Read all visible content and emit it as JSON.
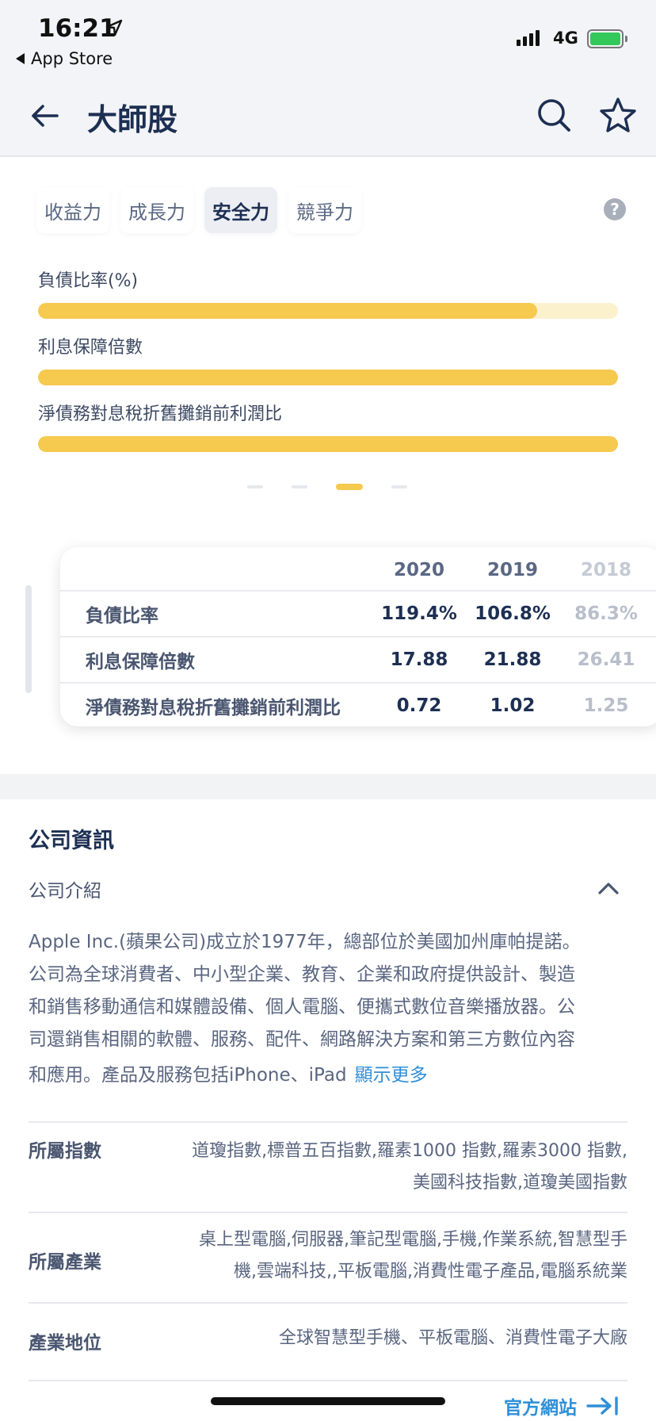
{
  "status_bar": {
    "time": "16:21",
    "back_app": "App Store",
    "network": "4G"
  },
  "header": {
    "title": "大師股",
    "icons": [
      "back-arrow-icon",
      "search-icon",
      "star-icon"
    ]
  },
  "tabs": [
    {
      "label": "收益力",
      "active": false
    },
    {
      "label": "成長力",
      "active": false
    },
    {
      "label": "安全力",
      "active": true
    },
    {
      "label": "競爭力",
      "active": false
    }
  ],
  "help_glyph": "?",
  "metrics": [
    {
      "label": "負債比率(%)",
      "fill": 0.86
    },
    {
      "label": "利息保障倍數",
      "fill": 1.0
    },
    {
      "label": "淨債務對息稅折舊攤銷前利潤比",
      "fill": 1.0
    }
  ],
  "pager": {
    "count": 4,
    "active_index": 2
  },
  "table": {
    "years": [
      "2020",
      "2019",
      "2018"
    ],
    "rows": [
      {
        "label": "負債比率",
        "values": [
          "119.4%",
          "106.8%",
          "86.3%"
        ]
      },
      {
        "label": "利息保障倍數",
        "values": [
          "17.88",
          "21.88",
          "26.41"
        ]
      },
      {
        "label": "淨債務對息稅折舊攤銷前利潤比",
        "values": [
          "0.72",
          "1.02",
          "1.25"
        ]
      }
    ]
  },
  "company": {
    "section_title": "公司資訊",
    "intro_title": "公司介紹",
    "intro_lines": [
      "Apple Inc.(蘋果公司)成立於1977年，總部位於美國加州庫帕提諾。",
      "公司為全球消費者、中小型企業、教育、企業和政府提供設計、製造",
      "和銷售移動通信和媒體設備、個人電腦、便攜式數位音樂播放器。公",
      "司還銷售相關的軟體、服務、配件、網路解決方案和第三方數位內容",
      "和應用。產品及服務包括iPhone、iPad"
    ],
    "show_more": "顯示更多",
    "details": [
      {
        "key": "所屬指數",
        "lines": [
          "道瓊指數,標普五百指數,羅素1000 指數,羅素3000 指數,",
          "美國科技指數,道瓊美國指數"
        ]
      },
      {
        "key": "所屬產業",
        "lines": [
          "桌上型電腦,伺服器,筆記型電腦,手機,作業系統,智慧型手",
          "機,雲端科技,,平板電腦,消費性電子產品,電腦系統業"
        ]
      },
      {
        "key": "產業地位",
        "lines": [
          "全球智慧型手機、平板電腦、消費性電子大廠"
        ]
      }
    ],
    "official_site": "官方網站"
  }
}
